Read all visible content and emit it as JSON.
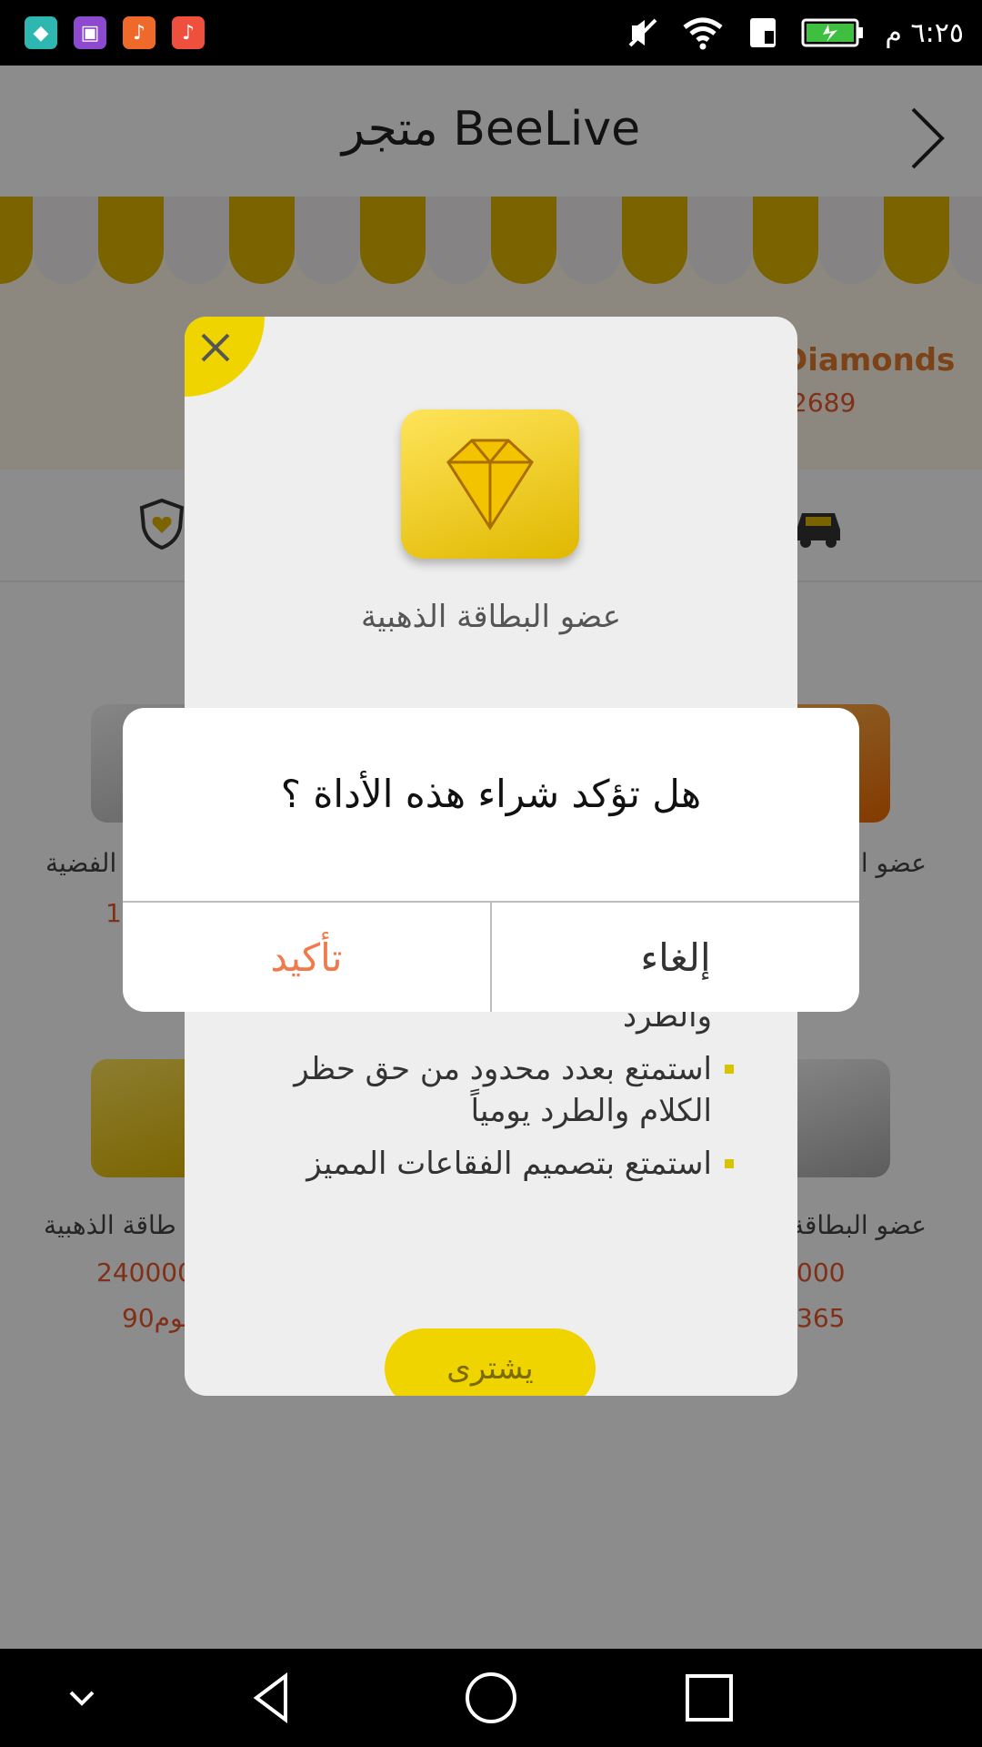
{
  "status_bar": {
    "time": "٦:٢٥ م",
    "app_icons": [
      "android-icon",
      "gallery-icon",
      "music-icon",
      "music-icon"
    ]
  },
  "header": {
    "title": "متجر BeeLive"
  },
  "banner": {
    "label": "Diamonds",
    "count": "2689"
  },
  "grid": {
    "cards": [
      {
        "name": "الفضية",
        "price": "1",
        "days": ""
      },
      {
        "name": "عضو البطاقة",
        "price": "",
        "days": ""
      },
      {
        "name": "طاقة الذهبية",
        "price": "240000",
        "days": "90يوم"
      },
      {
        "name": "عضو البطاقة",
        "price": "000",
        "days": "365"
      }
    ]
  },
  "sheet": {
    "title": "عضو البطاقة الذهبية",
    "benefits": [
      "الأدمن لهم الحق في حظر الكلام والطرد",
      "استمتع بعدد محدود من حق حظر الكلام والطرد يومياً",
      "استمتع بتصميم الفقاعات المميز"
    ],
    "buy_label": "يشترى"
  },
  "dialog": {
    "message": "هل تؤكد شراء هذه الأداة ؟",
    "confirm_label": "تأكيد",
    "cancel_label": "إلغاء"
  },
  "colors": {
    "accent_yellow": "#f0d400",
    "confirm_orange": "#f07a4b",
    "price_orange": "#e8582b"
  }
}
